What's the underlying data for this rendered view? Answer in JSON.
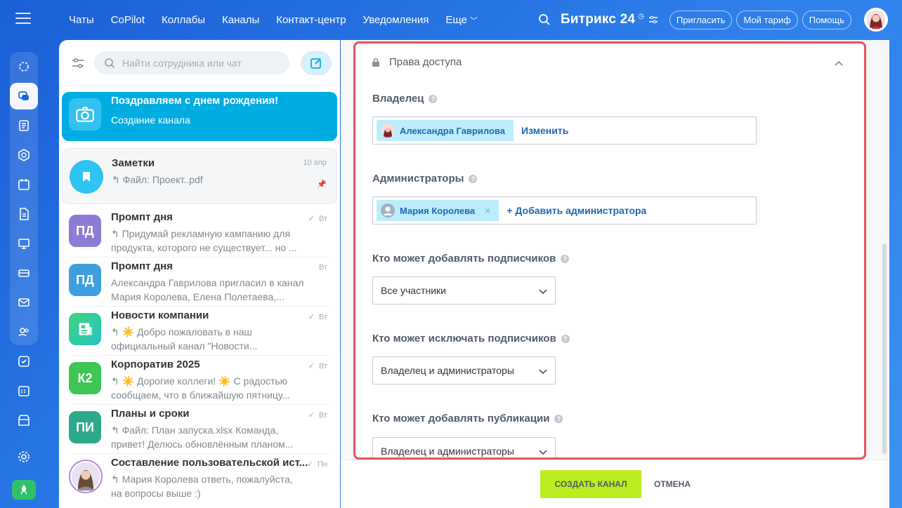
{
  "topnav": {
    "items": [
      "Чаты",
      "CoPilot",
      "Коллабы",
      "Каналы",
      "Контакт-центр",
      "Уведомления",
      "Еще"
    ],
    "brand": "Битрикс 24",
    "buttons": [
      "Пригласить",
      "Мой тариф",
      "Помощь"
    ]
  },
  "chatlist": {
    "search_placeholder": "Найти сотрудника или чат",
    "chats": [
      {
        "name": "Поздравляем с днем рождения!",
        "preview": "Создание канала",
        "date": "",
        "avatar": "camera"
      },
      {
        "name": "Заметки",
        "preview": "↰ Файл: Проект..pdf",
        "date": "10 апр",
        "avatar": "bookmark"
      },
      {
        "name": "Промпт дня",
        "preview": "↰ Придумай рекламную кампанию для продукта, которого не существует... но ...",
        "date": "Вт",
        "avatar": "ПД"
      },
      {
        "name": "Промпт дня",
        "preview": "Александра Гаврилова пригласил в канал Мария Королева, Елена Полетаева,...",
        "date": "Вт",
        "avatar": "ПД"
      },
      {
        "name": "Новости компании",
        "preview": "↰ ☀️ Добро пожаловать в наш официальный канал \"Новости...",
        "date": "Вт",
        "avatar": "news"
      },
      {
        "name": "Корпоратив 2025",
        "preview": "↰ ☀️ Дорогие коллеги! ☀️ С радостью сообщаем, что в ближайшую пятницу...",
        "date": "Вт",
        "avatar": "К2"
      },
      {
        "name": "Планы и сроки",
        "preview": "↰ Файл: План запуска.xlsx Команда, привет! Делюсь обновлённым планом...",
        "date": "Вт",
        "avatar": "ПИ"
      },
      {
        "name": "Составление пользовательской ист...",
        "preview": "↰ Мария Королева ответь, пожалуйста, на вопросы выше :)",
        "date": "Пн",
        "avatar": "photo"
      }
    ]
  },
  "settings": {
    "section_title": "Права доступа",
    "owner_label": "Владелец",
    "owner_name": "Александра Гаврилова",
    "owner_change": "Изменить",
    "admins_label": "Администраторы",
    "admin_name": "Мария Королева",
    "add_admin": "+ Добавить администратора",
    "add_subs_label": "Кто может добавлять подписчиков",
    "add_subs_value": "Все участники",
    "remove_subs_label": "Кто может исключать подписчиков",
    "remove_subs_value": "Владелец и администраторы",
    "publish_label": "Кто может добавлять публикации",
    "publish_value": "Владелец и администраторы"
  },
  "footer": {
    "create": "СОЗДАТЬ КАНАЛ",
    "cancel": "ОТМЕНА"
  },
  "colors": {
    "accent": "#00ade3",
    "highlight_border": "#e8535a",
    "create_button": "#bbed21"
  }
}
